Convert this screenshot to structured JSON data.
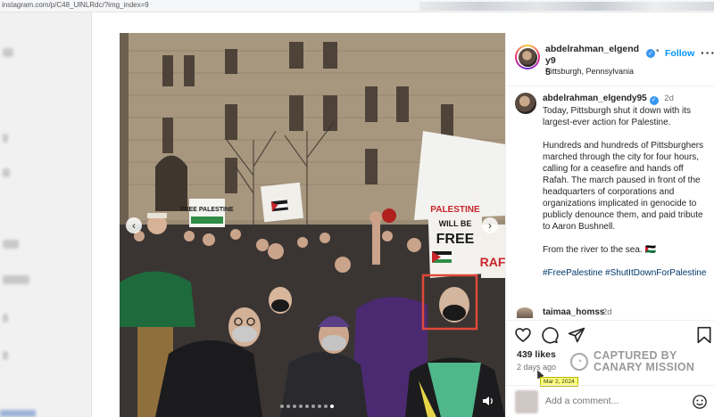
{
  "browser": {
    "url": "instagram.com/p/C48_UlNLRdc/?img_index=9"
  },
  "post": {
    "header": {
      "username_line1": "abdelrahman_elgendy9",
      "username_line2": "5",
      "follow_label": "Follow",
      "dot": "•",
      "location": "Pittsburgh, Pennsylvania",
      "more_label": "···"
    },
    "caption": {
      "username": "abdelrahman_elgendy95",
      "time": "2d",
      "para1": "Today, Pittsburgh shut it down with its largest-ever action for Palestine.",
      "para2": "Hundreds and hundreds of Pittsburghers marched through the city for four hours, calling for a ceasefire and hands off Rafah. The march paused in front of the headquarters of corporations and organizations implicated in genocide to publicly denounce them, and paid tribute to Aaron Bushnell.",
      "para3": "From the river to the sea. 🇵🇸",
      "hashtags": "#FreePalestine #ShutItDownForPalestine"
    },
    "comment": {
      "username": "taimaa_homss",
      "time": "2d"
    },
    "likes": "439 likes",
    "posted_ago": "2 days ago",
    "tooltip": "Mar 2, 2024",
    "watermark": {
      "line1": "CAPTURED BY",
      "line2": "CANARY MISSION"
    },
    "add_comment_placeholder": "Add a comment...",
    "media": {
      "carousel_total": 9,
      "carousel_active_index": 9,
      "signs": {
        "free_palestine_small": "FREE PALESTINE",
        "palestine_will_be_free_1": "PALESTINE",
        "palestine_will_be_free_2": "WILL BE",
        "palestine_will_be_free_3": "FREE",
        "raf": "RAF"
      }
    },
    "icons": {
      "heart": "heart-icon",
      "comment": "comment-icon",
      "share": "share-icon",
      "save": "bookmark-icon",
      "emoji": "emoji-icon",
      "verified": "verified-badge-icon"
    },
    "colors": {
      "follow": "#0095f6",
      "verified": "#3897f0",
      "hashtag": "#00376b",
      "tooltip_bg": "#ffff7a",
      "face_highlight": "#e0483a"
    }
  }
}
